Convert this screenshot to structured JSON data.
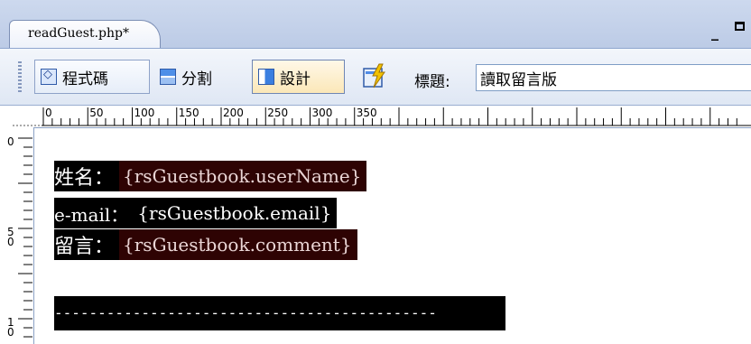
{
  "document_tab": {
    "label": "readGuest.php*"
  },
  "toolbar": {
    "code_label": "程式碼",
    "split_label": "分割",
    "design_label": "設計",
    "title_label": "標題:",
    "title_value": "讀取留言版"
  },
  "ruler": {
    "h_labels": [
      "0",
      "50",
      "100",
      "150",
      "200",
      "250",
      "300",
      "350"
    ],
    "v_labels": [
      "0",
      "5\n0",
      "1\n0"
    ]
  },
  "content": {
    "name_label": "姓名：",
    "name_value": "{rsGuestbook.userName}",
    "email_label": "e-mail：",
    "email_value": "{rsGuestbook.email}",
    "comment_label": "留言：",
    "comment_value": "{rsGuestbook.comment}",
    "divider": "--------------------------------------------"
  },
  "colors": {
    "label_bg": "#000000",
    "value_bg": "#2e0303",
    "tab_strip": "#c4d2ea"
  },
  "icons": [
    "code-view-icon",
    "split-view-icon",
    "design-view-icon",
    "lightning-icon",
    "minimize-icon",
    "restore-icon"
  ]
}
